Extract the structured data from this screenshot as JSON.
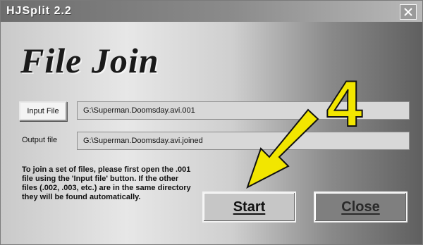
{
  "window": {
    "title": "HJSplit 2.2",
    "heading": "File Join"
  },
  "icons": {
    "close": "close-icon"
  },
  "input": {
    "button_label": "Input File",
    "path_value": "G:\\Superman.Doomsday.avi.001"
  },
  "output": {
    "label": "Output file",
    "path_value": "G:\\Superman.Doomsday.avi.joined"
  },
  "help_text": "To join a set of files, please first open the .001 file using the 'Input file' button. If the other files (.002, .003, etc.) are in the same directory they will be found automatically.",
  "actions": {
    "start_label": "Start",
    "close_label": "Close"
  },
  "annotation": {
    "step_number": "4",
    "color": "#f2e600"
  }
}
